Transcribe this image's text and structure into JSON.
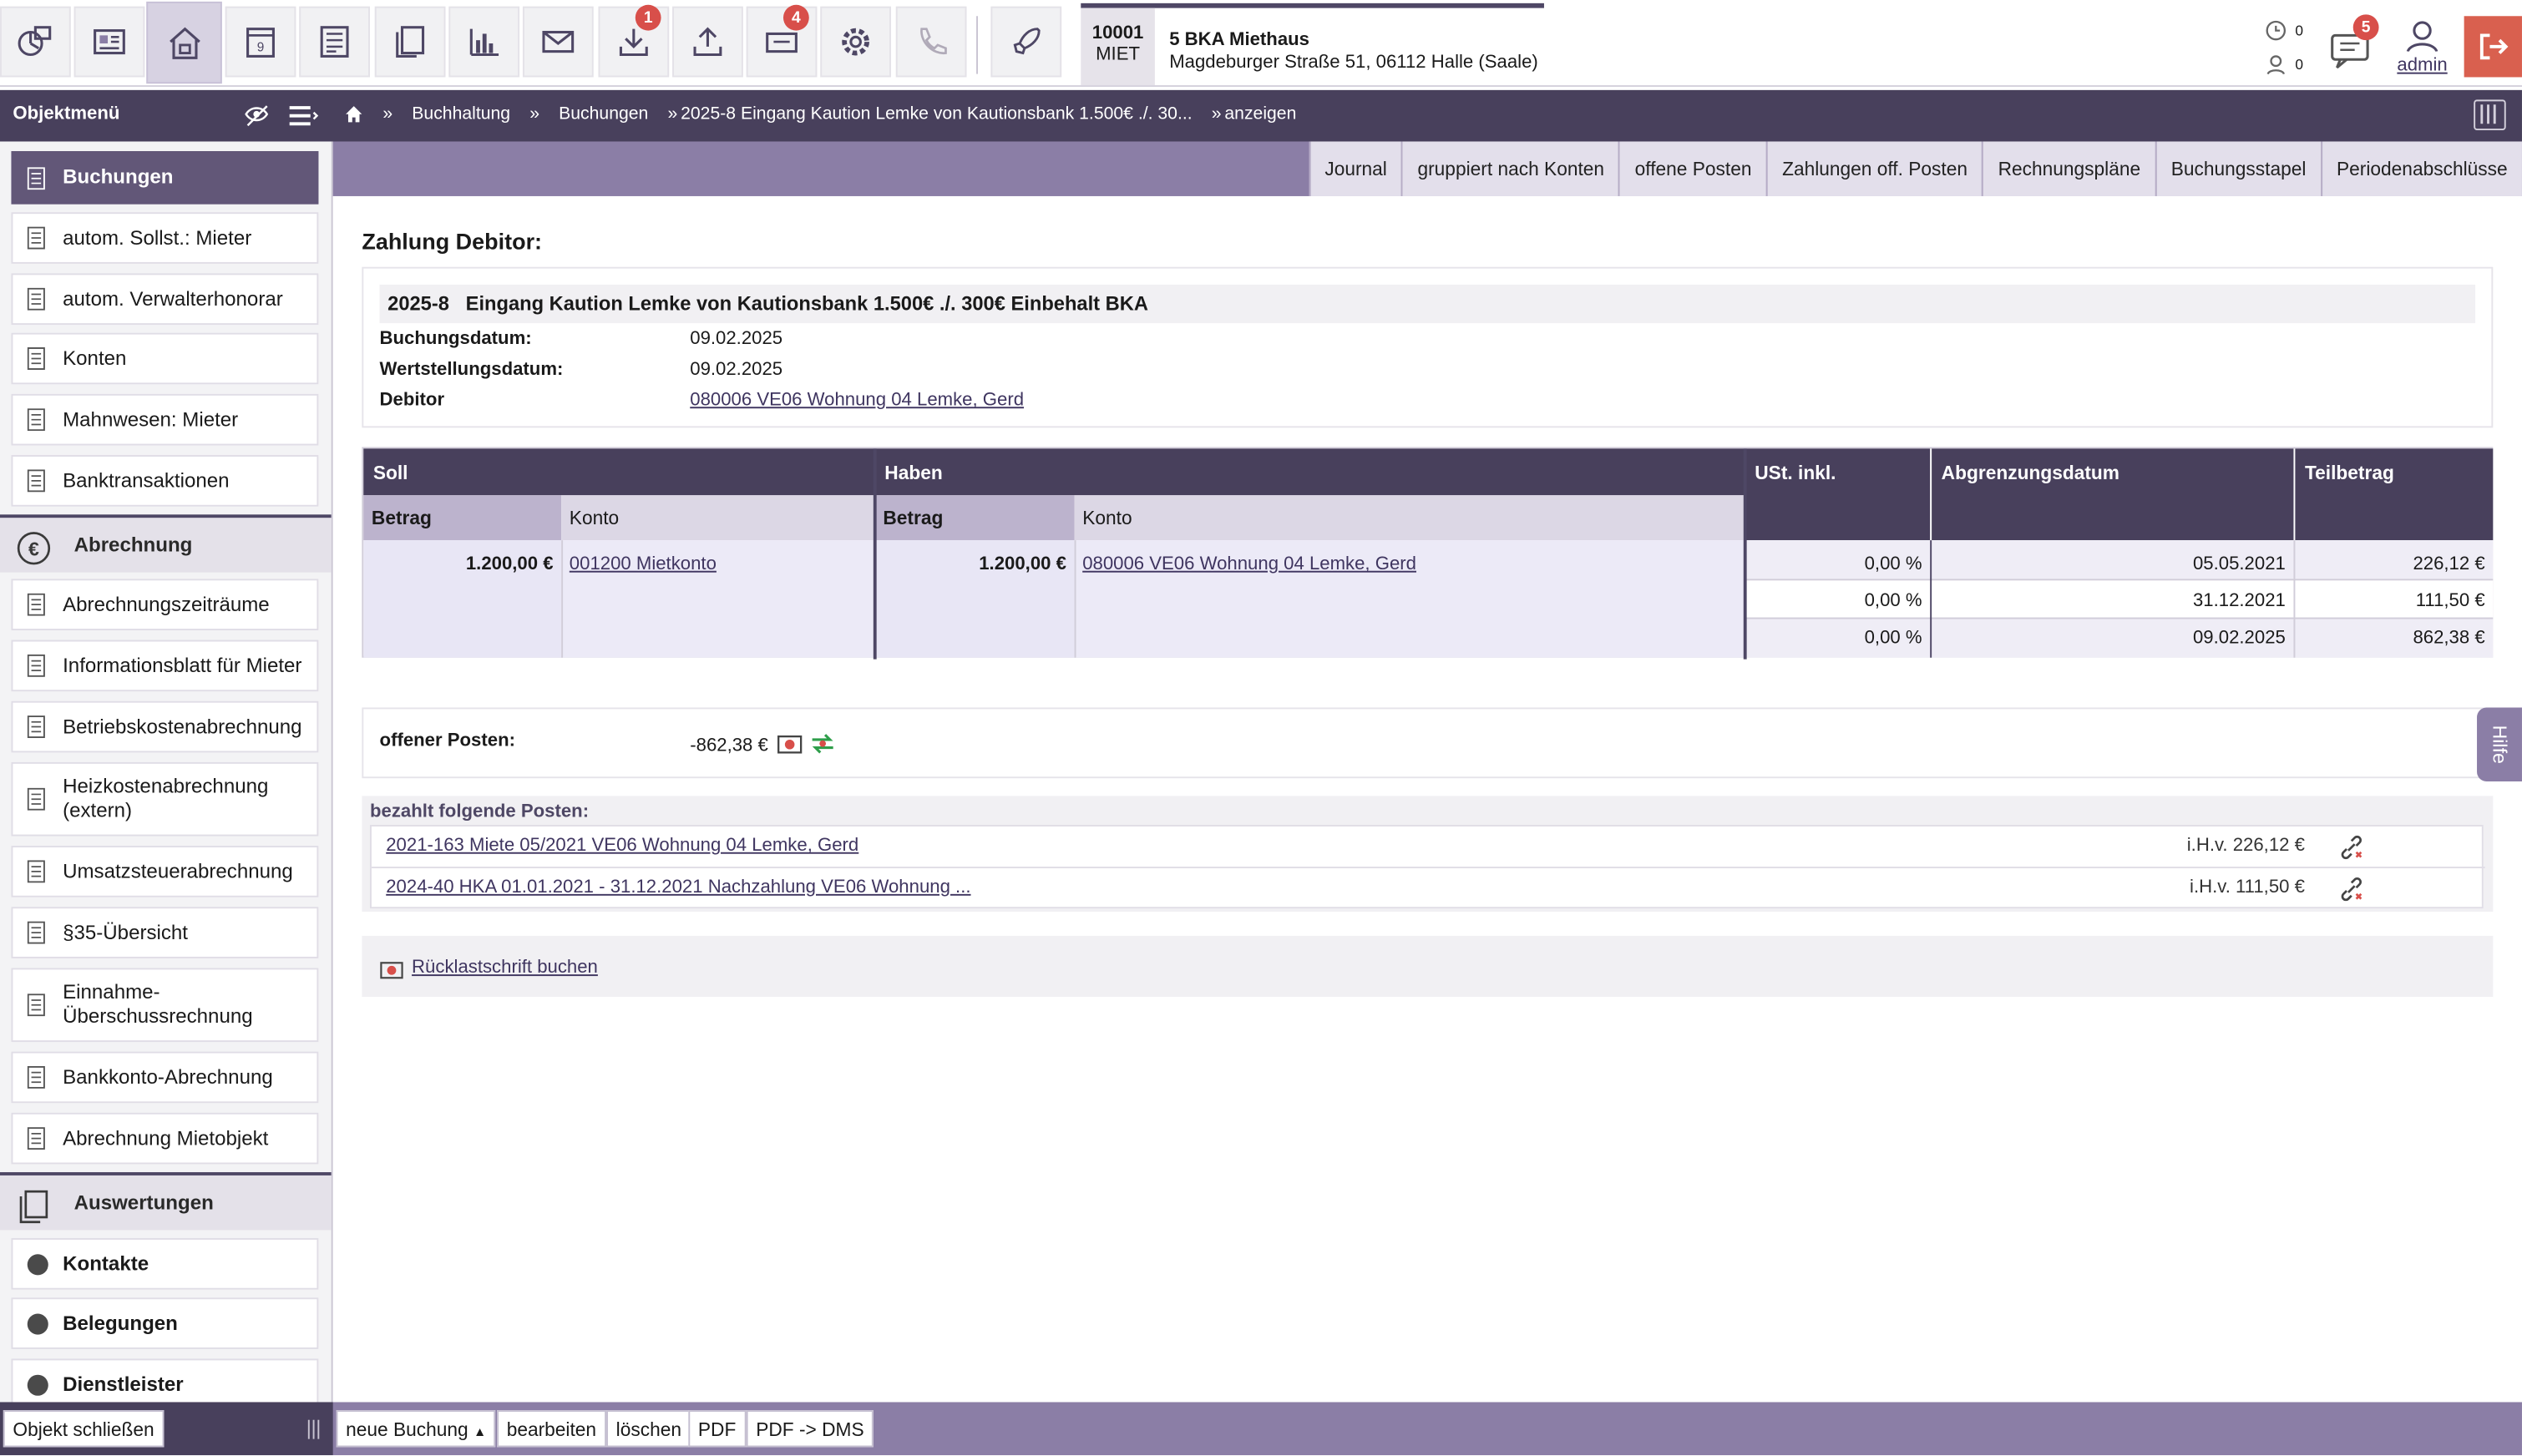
{
  "toolbar": {
    "buttons": [
      {
        "name": "dashboard-icon"
      },
      {
        "name": "object-card-icon"
      },
      {
        "name": "house-icon"
      },
      {
        "name": "calendar-icon",
        "label": "9"
      },
      {
        "name": "ledger-icon"
      },
      {
        "name": "documents-icon"
      },
      {
        "name": "statistics-icon"
      },
      {
        "name": "mail-icon"
      },
      {
        "name": "download-icon",
        "badge": "1"
      },
      {
        "name": "upload-icon"
      },
      {
        "name": "tickets-icon",
        "badge": "4"
      },
      {
        "name": "gear-icon"
      },
      {
        "name": "phone-icon"
      },
      {
        "name": "rocket-icon"
      }
    ],
    "object_code_top": "10001",
    "object_code_bottom": "MIET",
    "object_name": "5 BKA Miethaus",
    "object_address": "Magdeburger Straße 51, 06112 Halle (Saale)",
    "counter1": "0",
    "counter2": "0",
    "messages_badge": "5",
    "user": "admin"
  },
  "menu_title": "Objektmenü",
  "breadcrumb": [
    "Buchhaltung",
    "Buchungen",
    "2025-8 Eingang Kaution Lemke von Kautionsbank 1.500€ ./. 30...",
    "anzeigen"
  ],
  "tabs": [
    "Journal",
    "gruppiert nach Konten",
    "offene Posten",
    "Zahlungen off. Posten",
    "Rechnungspläne",
    "Buchungsstapel",
    "Periodenabschlüsse"
  ],
  "sidebar": {
    "group1": [
      "Buchungen",
      "autom. Sollst.: Mieter",
      "autom. Verwalterhonorar",
      "Konten",
      "Mahnwesen: Mieter",
      "Banktransaktionen"
    ],
    "section_abrechnung": "Abrechnung",
    "group2": [
      "Abrechnungszeiträume",
      "Informationsblatt für Mieter",
      "Betriebskostenabrechnung",
      "Heizkostenabrechnung (extern)",
      "Umsatzsteuerabrechnung",
      "§35-Übersicht",
      "Einnahme-Überschussrechnung",
      "Bankkonto-Abrechnung",
      "Abrechnung Mietobjekt"
    ],
    "section_auswertungen": "Auswertungen",
    "collapsed": [
      "Kontakte",
      "Belegungen",
      "Dienstleister"
    ]
  },
  "main": {
    "title": "Zahlung Debitor:",
    "booking_number": "2025-8",
    "booking_text": "Eingang Kaution Lemke von Kautionsbank 1.500€ ./. 300€ Einbehalt BKA",
    "labels": {
      "buchungsdatum": "Buchungsdatum:",
      "wertstellung": "Wertstellungsdatum:",
      "debitor": "Debitor"
    },
    "buchungsdatum": "09.02.2025",
    "wertstellungsdatum": "09.02.2025",
    "debitor": "080006 VE06 Wohnung 04 Lemke, Gerd",
    "table": {
      "soll": "Soll",
      "haben": "Haben",
      "ust": "USt. inkl.",
      "abgrenzung": "Abgrenzungsdatum",
      "teilbetrag": "Teilbetrag",
      "betrag": "Betrag",
      "konto": "Konto",
      "soll_betrag": "1.200,00 €",
      "soll_konto": "001200 Mietkonto",
      "haben_betrag": "1.200,00 €",
      "haben_konto": "080006 VE06 Wohnung 04 Lemke, Gerd",
      "rows": [
        {
          "ust": "0,00 %",
          "datum": "05.05.2021",
          "teil": "226,12 €"
        },
        {
          "ust": "0,00 %",
          "datum": "31.12.2021",
          "teil": "111,50 €"
        },
        {
          "ust": "0,00 %",
          "datum": "09.02.2025",
          "teil": "862,38 €"
        }
      ]
    },
    "open_label": "offener Posten:",
    "open_value": "-862,38 €",
    "paid_title": "bezahlt folgende Posten:",
    "paid": [
      {
        "text": "2021-163 Miete 05/2021 VE06 Wohnung 04 Lemke, Gerd",
        "amount": "i.H.v. 226,12 €"
      },
      {
        "text": "2024-40 HKA 01.01.2021 - 31.12.2021 Nachzahlung VE06 Wohnung ...",
        "amount": "i.H.v. 111,50 €"
      }
    ],
    "ruecklast": "Rücklastschrift buchen",
    "help": "Hilfe"
  },
  "bottom": {
    "close": "Objekt schließen",
    "buttons": [
      "neue Buchung",
      "bearbeiten",
      "löschen",
      "PDF",
      "PDF -> DMS"
    ]
  },
  "colors": {
    "dark": "#48405c",
    "accent": "#8b7ea6",
    "badge": "#d84f4a",
    "logout": "#d9604f"
  }
}
